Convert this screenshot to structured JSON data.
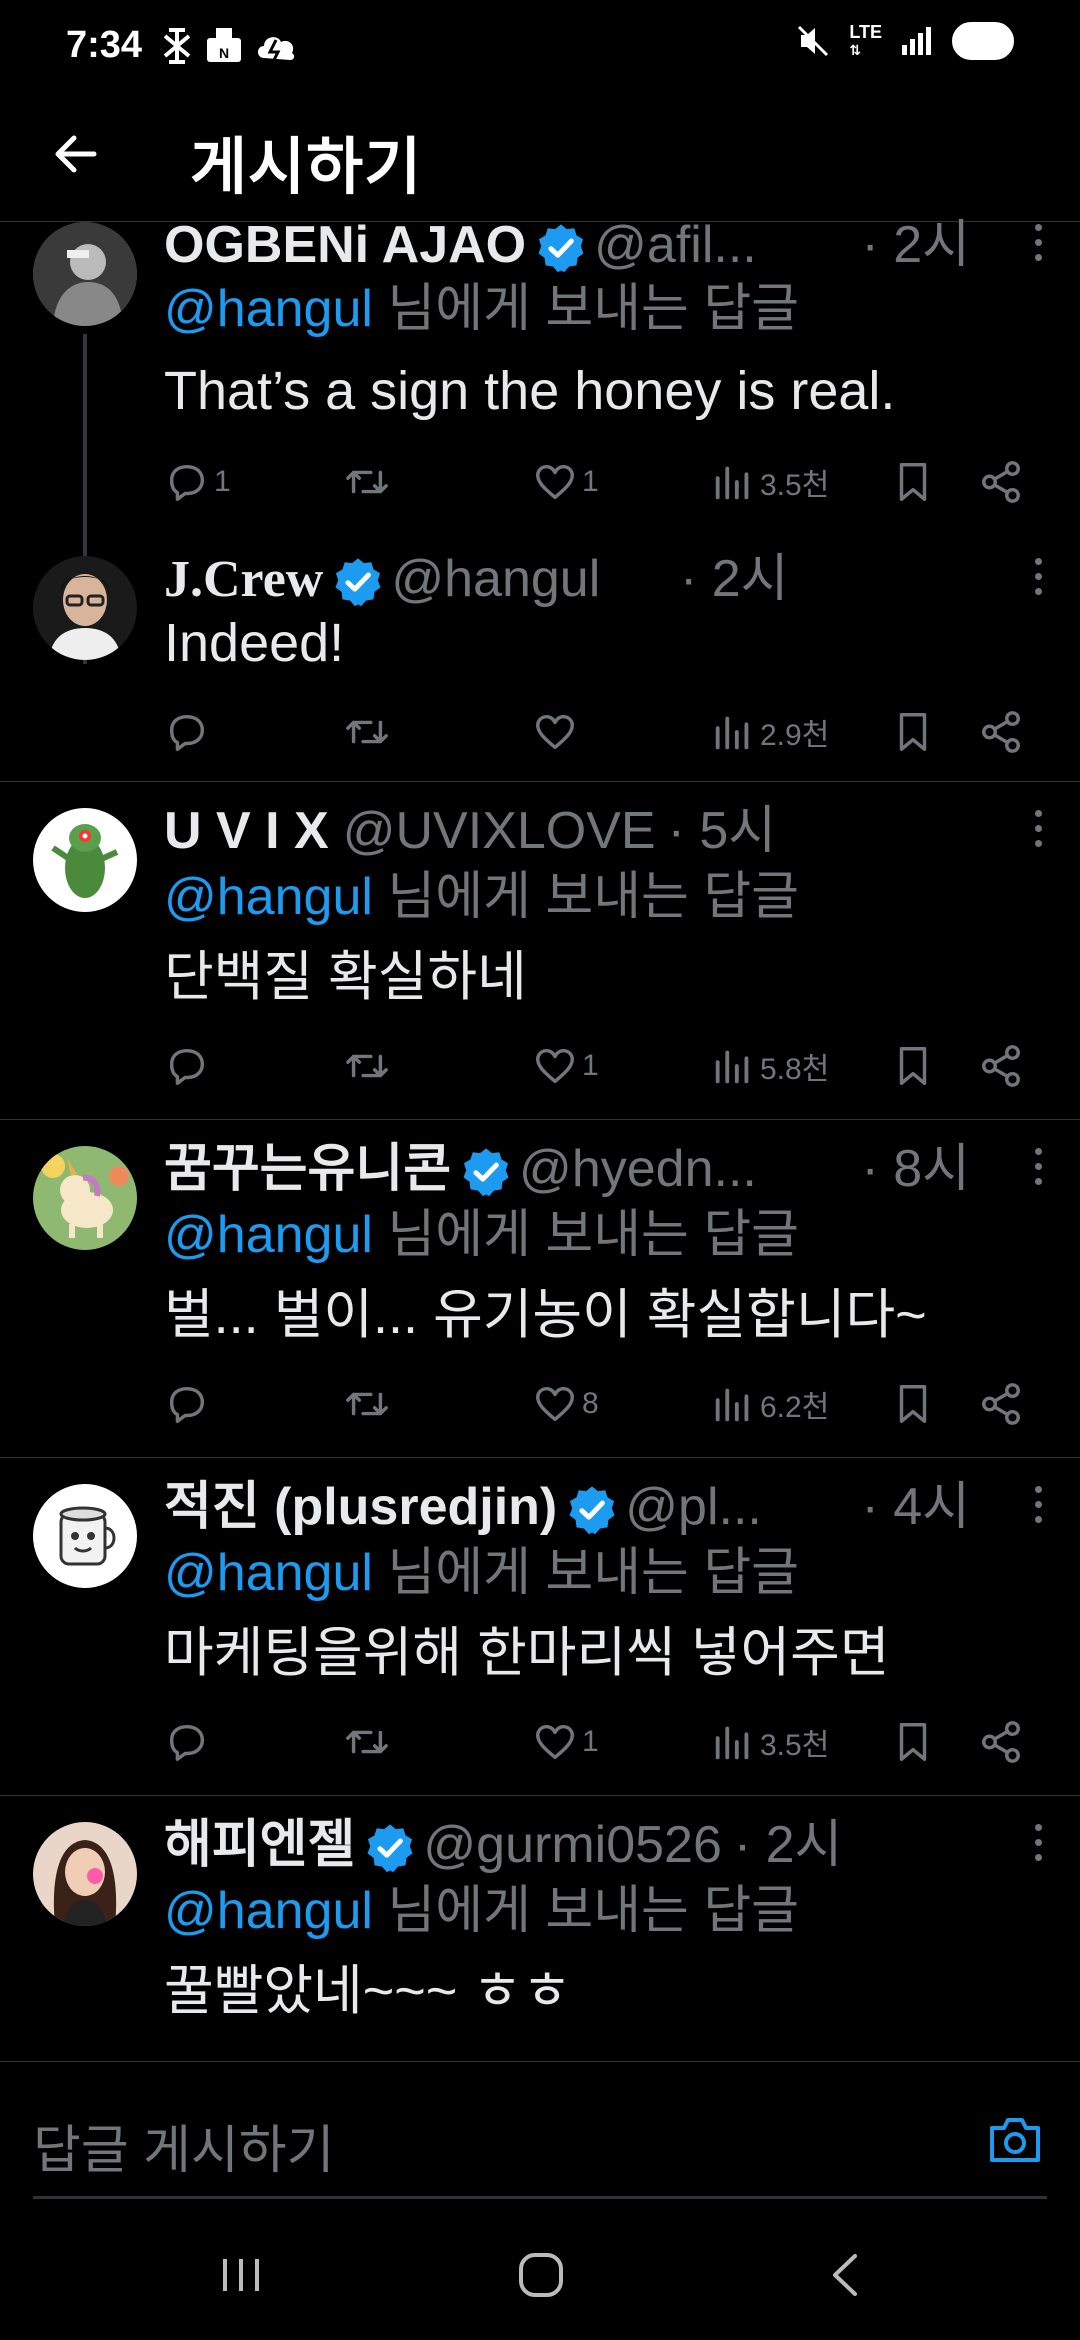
{
  "status_bar": {
    "time": "7:34",
    "network": "LTE",
    "left_icons": [
      "carrier-icon",
      "mail-icon",
      "cloud-icon"
    ],
    "right_icons": [
      "mute-icon",
      "lte-icon",
      "signal-icon",
      "battery-icon"
    ]
  },
  "header": {
    "title": "게시하기",
    "back_icon": "arrow-left-icon"
  },
  "tweets": [
    {
      "name": "OGBENi AJAO",
      "verified": true,
      "handle": "@afil...",
      "time": "· 2시",
      "reply_prefix": "@hangul",
      "reply_suffix": " 님에게 보내는 답글",
      "text": "That’s a sign the honey is real.",
      "replies": "1",
      "retweets": "",
      "likes": "1",
      "views": "3.5천"
    },
    {
      "name": "J.Crew",
      "verified": true,
      "handle": "@hangul",
      "time": "· 2시",
      "text": "Indeed!",
      "replies": "",
      "retweets": "",
      "likes": "",
      "views": "2.9천"
    },
    {
      "name": "U V I X",
      "verified": false,
      "handle": "@UVIXLOVE",
      "time": "· 5시",
      "reply_prefix": "@hangul",
      "reply_suffix": " 님에게 보내는 답글",
      "text": "단백질 확실하네",
      "replies": "",
      "retweets": "",
      "likes": "1",
      "views": "5.8천"
    },
    {
      "name": "꿈꾸는유니콘",
      "verified": true,
      "handle": "@hyedn...",
      "time": "· 8시",
      "reply_prefix": "@hangul",
      "reply_suffix": " 님에게 보내는 답글",
      "text": "벌... 벌이... 유기농이 확실합니다~",
      "replies": "",
      "retweets": "",
      "likes": "8",
      "views": "6.2천"
    },
    {
      "name": "적진 (plusredjin)",
      "verified": true,
      "handle": "@pl...",
      "time": "· 4시",
      "reply_prefix": "@hangul",
      "reply_suffix": " 님에게 보내는 답글",
      "text": "마케팅을위해 한마리씩 넣어주면",
      "replies": "",
      "retweets": "",
      "likes": "1",
      "views": "3.5천"
    },
    {
      "name": "해피엔젤",
      "verified": true,
      "handle": "@gurmi0526",
      "time": "· 2시",
      "reply_prefix": "@hangul",
      "reply_suffix": " 님에게 보내는 답글",
      "text": "꿀빨았네~~~ ㅎㅎ"
    }
  ],
  "compose": {
    "placeholder": "답글 게시하기",
    "icon": "camera-icon"
  },
  "colors": {
    "background": "#000000",
    "accent": "#1d9bf0",
    "muted": "#71767b",
    "text": "#e7e9ea"
  },
  "nav_bar": {
    "icons": [
      "recent-apps-icon",
      "home-icon",
      "back-icon"
    ]
  }
}
